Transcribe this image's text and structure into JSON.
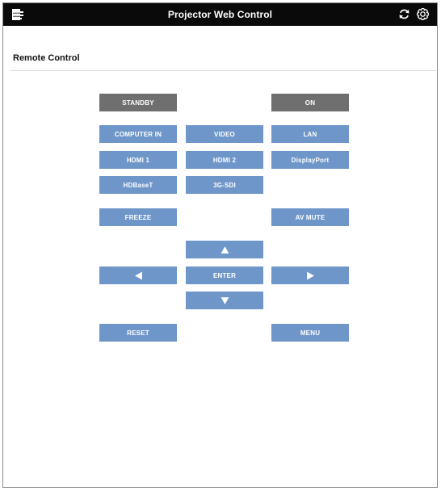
{
  "header": {
    "title": "Projector Web Control",
    "menu_icon": "menu-icon",
    "refresh_icon": "refresh-icon",
    "settings_icon": "settings-icon"
  },
  "section": {
    "title": "Remote Control"
  },
  "buttons": {
    "standby": "STANDBY",
    "on": "ON",
    "computer_in": "COMPUTER IN",
    "video": "VIDEO",
    "lan": "LAN",
    "hdmi1": "HDMI 1",
    "hdmi2": "HDMI 2",
    "displayport": "DisplayPort",
    "hdbaset": "HDBaseT",
    "sdi": "3G-SDI",
    "freeze": "FREEZE",
    "av_mute": "AV MUTE",
    "enter": "ENTER",
    "reset": "RESET",
    "menu": "MENU"
  },
  "arrows": {
    "up": "arrow-up-icon",
    "left": "arrow-left-icon",
    "right": "arrow-right-icon",
    "down": "arrow-down-icon"
  },
  "colors": {
    "titlebar": "#0a0a0a",
    "button_blue": "#6e96c8",
    "button_gray": "#6f6f6f"
  }
}
